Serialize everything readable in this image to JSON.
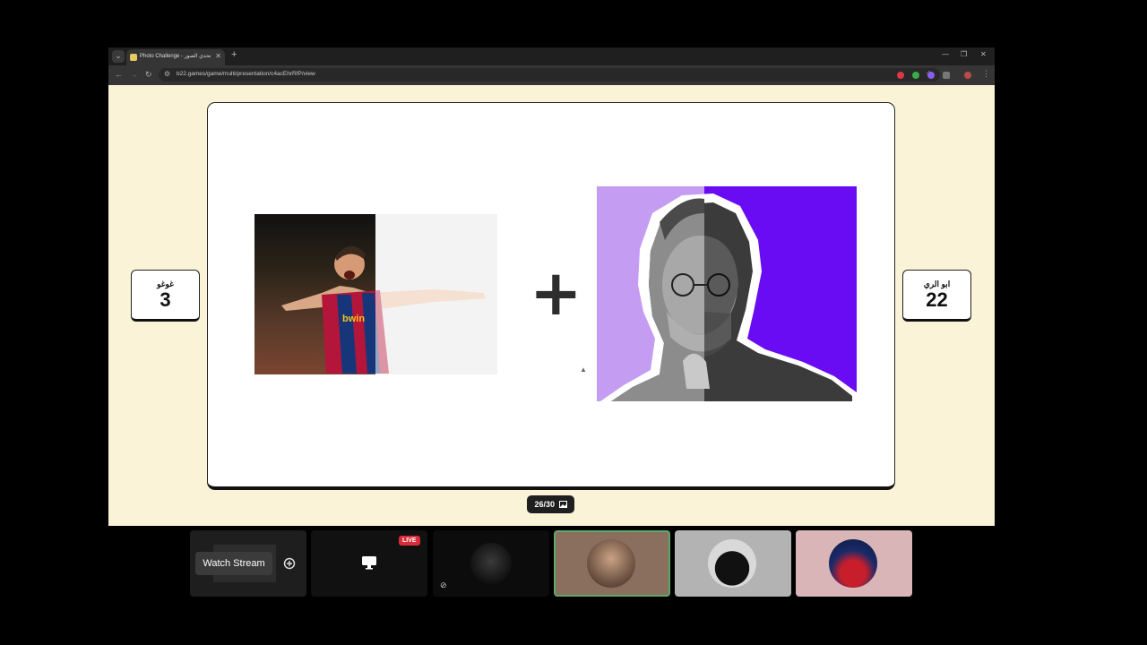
{
  "browser": {
    "tab_title": "Photo Challenge - تحدي الصور",
    "url": "b22.games/game/multi/presentation/c4acEhrRfP/view",
    "dropdown_glyph": "⌄",
    "close_glyph": "✕",
    "new_tab_glyph": "+",
    "minimize_glyph": "—",
    "restore_glyph": "❐",
    "window_close_glyph": "✕",
    "back_glyph": "←",
    "forward_glyph": "→",
    "reload_glyph": "↻",
    "tune_glyph": "⚙",
    "star_glyph": "☆",
    "menu_glyph": "⋮"
  },
  "game": {
    "left_team": {
      "name": "غوغو",
      "score": "3"
    },
    "right_team": {
      "name": "ابو الري",
      "score": "22"
    },
    "plus_sign": "+",
    "progress": "26/30",
    "progress_icon": "image-icon",
    "left_photo_label": "bwin"
  },
  "call": {
    "watch_stream_label": "Watch Stream",
    "live_badge": "LIVE",
    "tiles": [
      "stream-preview",
      "screen-share",
      "participant-dark",
      "participant-photo",
      "participant-mask",
      "participant-player"
    ],
    "active_speaker_color": "#5fa86a"
  },
  "colors": {
    "page_bg": "#fbf3d8",
    "purple_light": "#c49df3",
    "purple_dark": "#6a0cf3",
    "live_red": "#d92c3a"
  }
}
